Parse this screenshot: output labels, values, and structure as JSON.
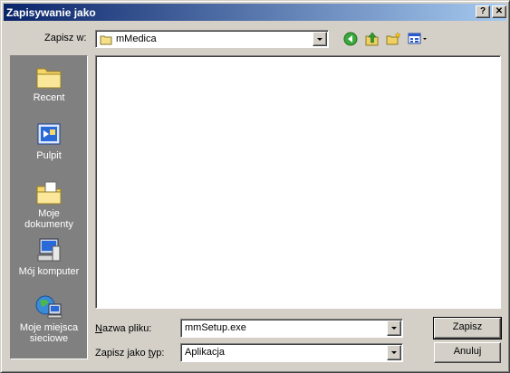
{
  "window": {
    "title": "Zapisywanie jako"
  },
  "titlebar": {
    "help_glyph": "?",
    "close_glyph": "✕"
  },
  "savein": {
    "label": "Zapisz w:",
    "value": "mMedica"
  },
  "toolbar": {
    "icons": [
      "back-icon",
      "up-folder-icon",
      "new-folder-icon",
      "view-menu-icon"
    ]
  },
  "places": {
    "items": [
      {
        "label": "Recent",
        "icon": "recent-folder-icon"
      },
      {
        "label": "Pulpit",
        "icon": "desktop-icon"
      },
      {
        "label_line1": "Moje",
        "label_line2": "dokumenty",
        "icon": "my-documents-icon"
      },
      {
        "label": "Mój komputer",
        "icon": "my-computer-icon"
      },
      {
        "label_line1": "Moje miejsca",
        "label_line2": "sieciowe",
        "icon": "network-places-icon"
      }
    ]
  },
  "filename": {
    "label_prefix": "N",
    "label_rest": "azwa pliku:",
    "value": "mmSetup.exe"
  },
  "filetype": {
    "label_prefix": "Zapisz jako ",
    "label_u": "t",
    "label_rest": "yp:",
    "value": "Aplikacja"
  },
  "buttons": {
    "save": "Zapisz",
    "cancel": "Anuluj"
  },
  "colors": {
    "titlebar_start": "#0a246a",
    "titlebar_end": "#a6caf0",
    "places_bg": "#808080",
    "face": "#d4d0c8"
  }
}
